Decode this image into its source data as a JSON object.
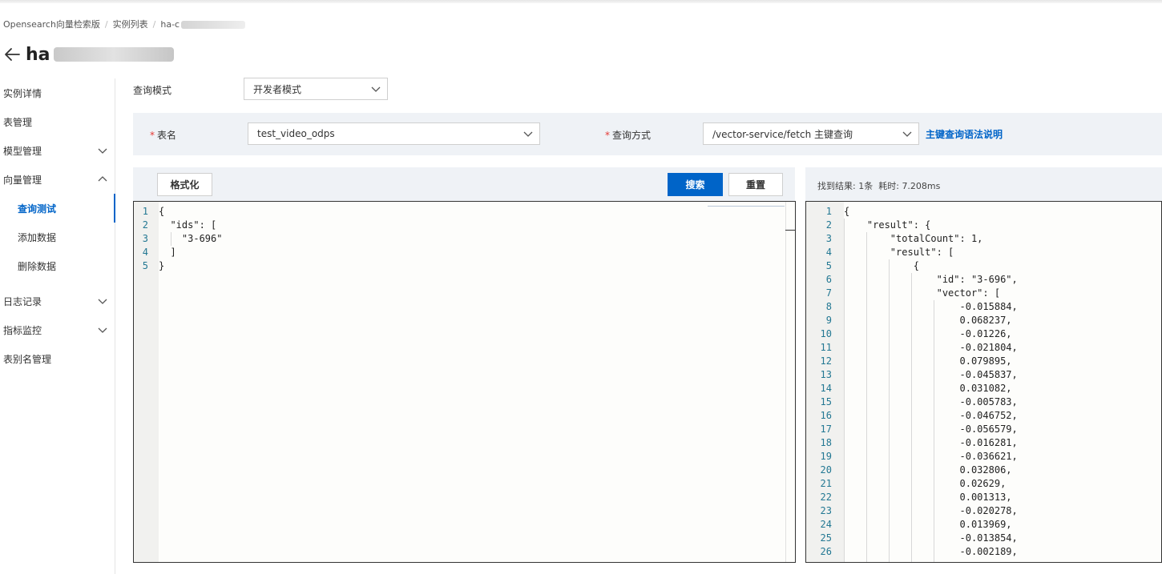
{
  "breadcrumb": {
    "items": [
      "Opensearch向量检索版",
      "实例列表",
      "ha-c"
    ]
  },
  "page": {
    "title_prefix": "ha"
  },
  "sidebar": {
    "items": [
      {
        "label": "实例详情"
      },
      {
        "label": "表管理"
      },
      {
        "label": "模型管理",
        "icon": "chevron-down-icon"
      },
      {
        "label": "向量管理",
        "icon": "chevron-up-icon"
      },
      {
        "label": "查询测试",
        "active": true
      },
      {
        "label": "添加数据"
      },
      {
        "label": "删除数据"
      },
      {
        "label": "日志记录",
        "icon": "chevron-down-icon"
      },
      {
        "label": "指标监控",
        "icon": "chevron-down-icon"
      },
      {
        "label": "表别名管理"
      }
    ]
  },
  "query": {
    "mode_label": "查询模式",
    "mode_value": "开发者模式",
    "table_label": "表名",
    "table_value": "test_video_odps",
    "method_label": "查询方式",
    "method_value": "/vector-service/fetch 主键查询",
    "help_link": "主键查询语法说明"
  },
  "toolbar": {
    "format_label": "格式化",
    "search_label": "搜索",
    "reset_label": "重置"
  },
  "result_info": {
    "found_label": "找到结果:",
    "found_value": "1条",
    "time_label": "耗时:",
    "time_value": "7.208ms"
  },
  "request_editor": {
    "lines": [
      {
        "n": "1",
        "text": "{"
      },
      {
        "n": "2",
        "text": "  \"ids\": ["
      },
      {
        "n": "3",
        "text": "    \"3-696\""
      },
      {
        "n": "4",
        "text": "  ]"
      },
      {
        "n": "5",
        "text": "}"
      }
    ]
  },
  "response_editor": {
    "lines": [
      {
        "n": "1",
        "text": "{"
      },
      {
        "n": "2",
        "text": "    \"result\": {"
      },
      {
        "n": "3",
        "text": "        \"totalCount\": 1,"
      },
      {
        "n": "4",
        "text": "        \"result\": ["
      },
      {
        "n": "5",
        "text": "            {"
      },
      {
        "n": "6",
        "text": "                \"id\": \"3-696\","
      },
      {
        "n": "7",
        "text": "                \"vector\": ["
      },
      {
        "n": "8",
        "text": "                    -0.015884,"
      },
      {
        "n": "9",
        "text": "                    0.068237,"
      },
      {
        "n": "10",
        "text": "                    -0.01226,"
      },
      {
        "n": "11",
        "text": "                    -0.021804,"
      },
      {
        "n": "12",
        "text": "                    0.079895,"
      },
      {
        "n": "13",
        "text": "                    -0.045837,"
      },
      {
        "n": "14",
        "text": "                    0.031082,"
      },
      {
        "n": "15",
        "text": "                    -0.005783,"
      },
      {
        "n": "16",
        "text": "                    -0.046752,"
      },
      {
        "n": "17",
        "text": "                    -0.056579,"
      },
      {
        "n": "18",
        "text": "                    -0.016281,"
      },
      {
        "n": "19",
        "text": "                    -0.036621,"
      },
      {
        "n": "20",
        "text": "                    0.032806,"
      },
      {
        "n": "21",
        "text": "                    0.02629,"
      },
      {
        "n": "22",
        "text": "                    0.001313,"
      },
      {
        "n": "23",
        "text": "                    -0.020278,"
      },
      {
        "n": "24",
        "text": "                    0.013969,"
      },
      {
        "n": "25",
        "text": "                    -0.013854,"
      },
      {
        "n": "26",
        "text": "                    -0.002189,"
      }
    ]
  },
  "colors": {
    "accent": "#0064c8",
    "required": "#e53935",
    "panel_bg": "#eff2f6",
    "line_number": "#237893"
  }
}
